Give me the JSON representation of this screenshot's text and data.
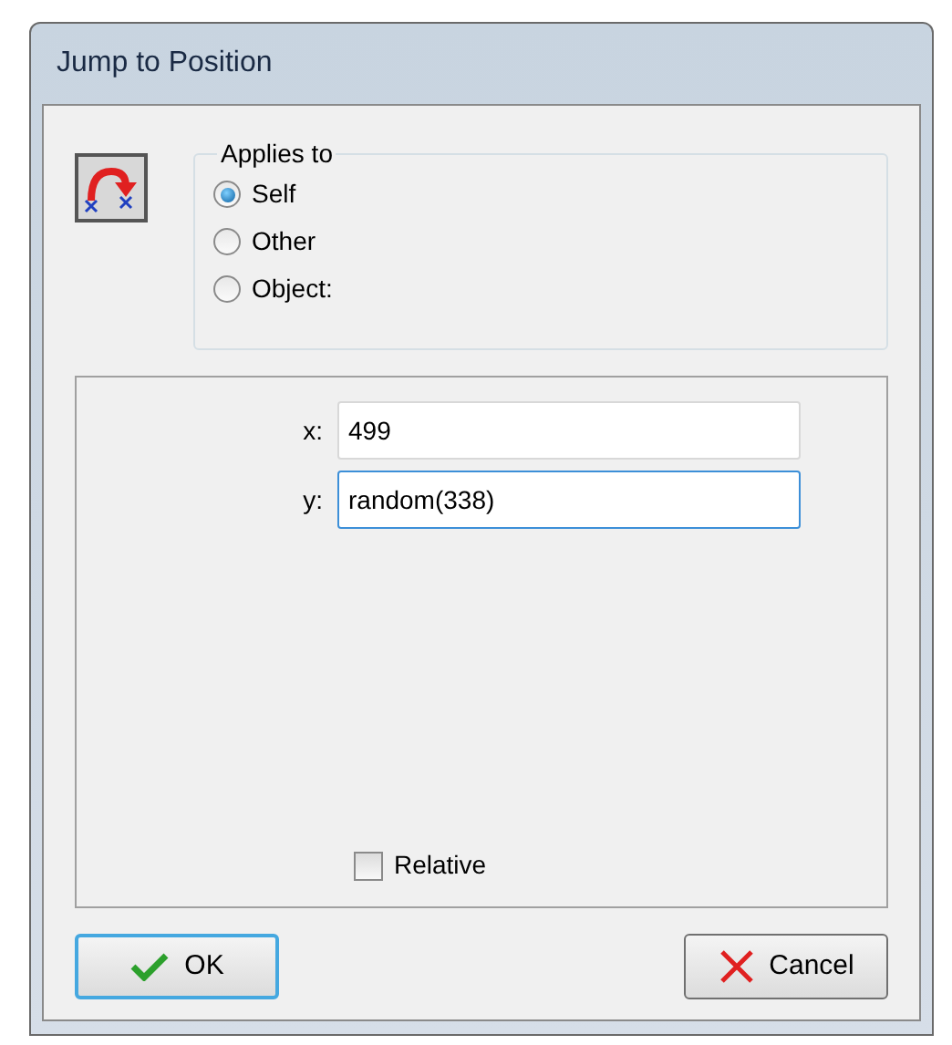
{
  "window": {
    "title": "Jump to Position"
  },
  "applies_to": {
    "legend": "Applies to",
    "options": [
      {
        "label": "Self",
        "selected": true
      },
      {
        "label": "Other",
        "selected": false
      },
      {
        "label": "Object:",
        "selected": false
      }
    ]
  },
  "fields": [
    {
      "label": "x:",
      "value": "499",
      "focused": false
    },
    {
      "label": "y:",
      "value": "random(338)",
      "focused": true
    }
  ],
  "relative": {
    "label": "Relative",
    "checked": false
  },
  "buttons": [
    {
      "kind": "ok",
      "label": "OK",
      "default": true
    },
    {
      "kind": "cancel",
      "label": "Cancel",
      "default": false
    }
  ]
}
